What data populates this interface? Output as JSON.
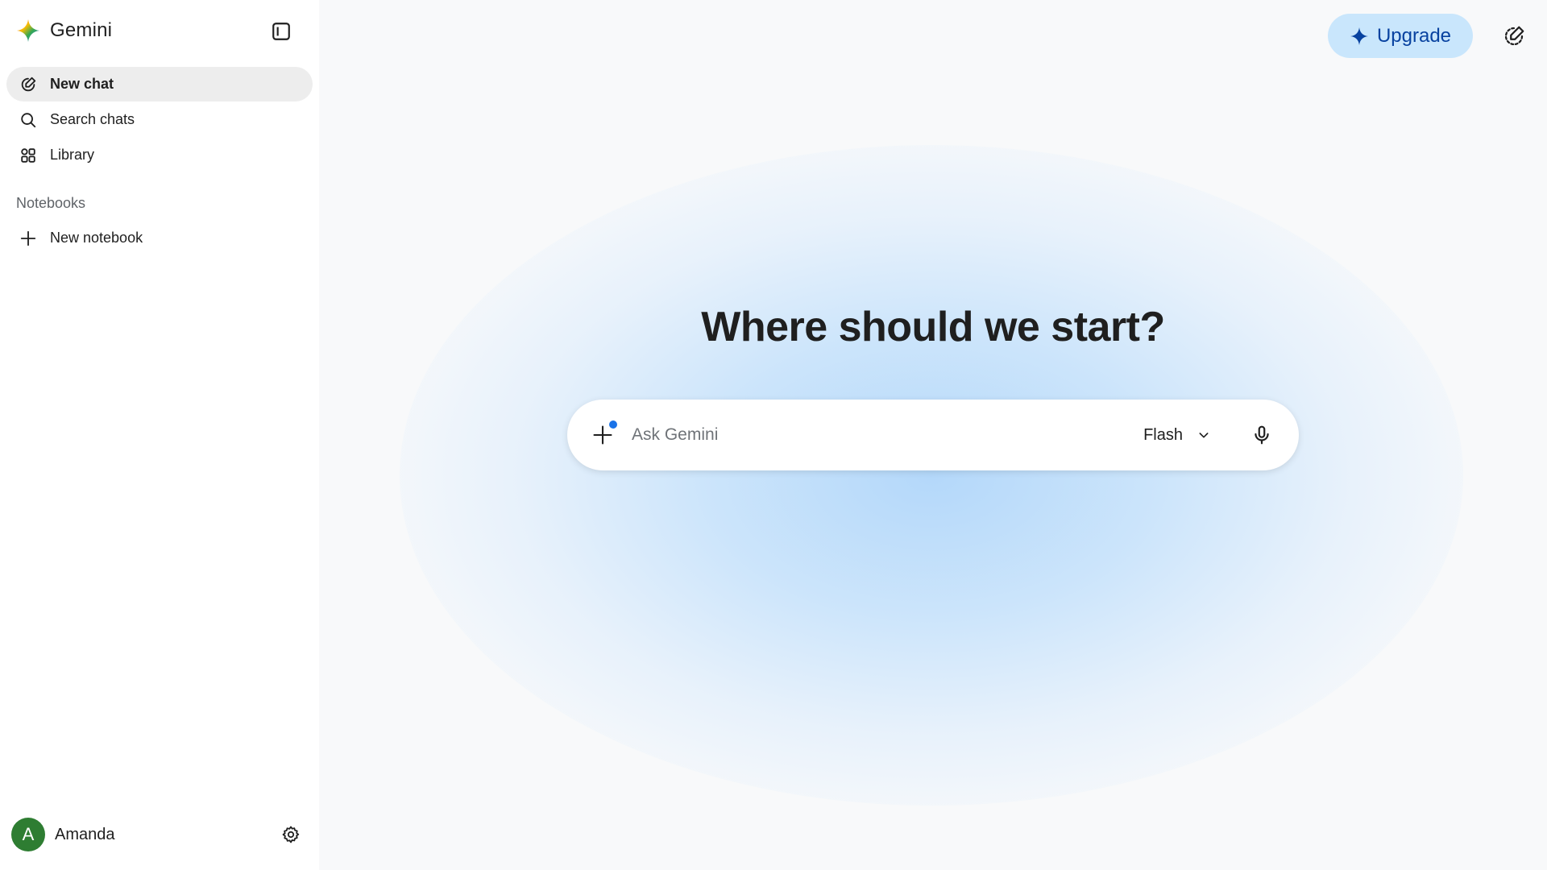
{
  "app": {
    "name": "Gemini"
  },
  "sidebar": {
    "items": [
      {
        "label": "New chat",
        "icon": "edit-icon",
        "active": true
      },
      {
        "label": "Search chats",
        "icon": "search-icon",
        "active": false
      },
      {
        "label": "Library",
        "icon": "library-icon",
        "active": false
      }
    ],
    "notebooks": {
      "title": "Notebooks",
      "new_label": "New notebook"
    },
    "user": {
      "initial": "A",
      "name": "Amanda"
    }
  },
  "header": {
    "upgrade_label": "Upgrade"
  },
  "main": {
    "title": "Where should we start?",
    "prompt": {
      "placeholder": "Ask Gemini",
      "value": "",
      "model": "Flash"
    }
  },
  "colors": {
    "accent": "#0b57d0",
    "upgrade_bg": "#c9e6fc",
    "active_nav_bg": "#ededed",
    "avatar_bg": "#2e7d32",
    "dot": "#1a73e8"
  }
}
